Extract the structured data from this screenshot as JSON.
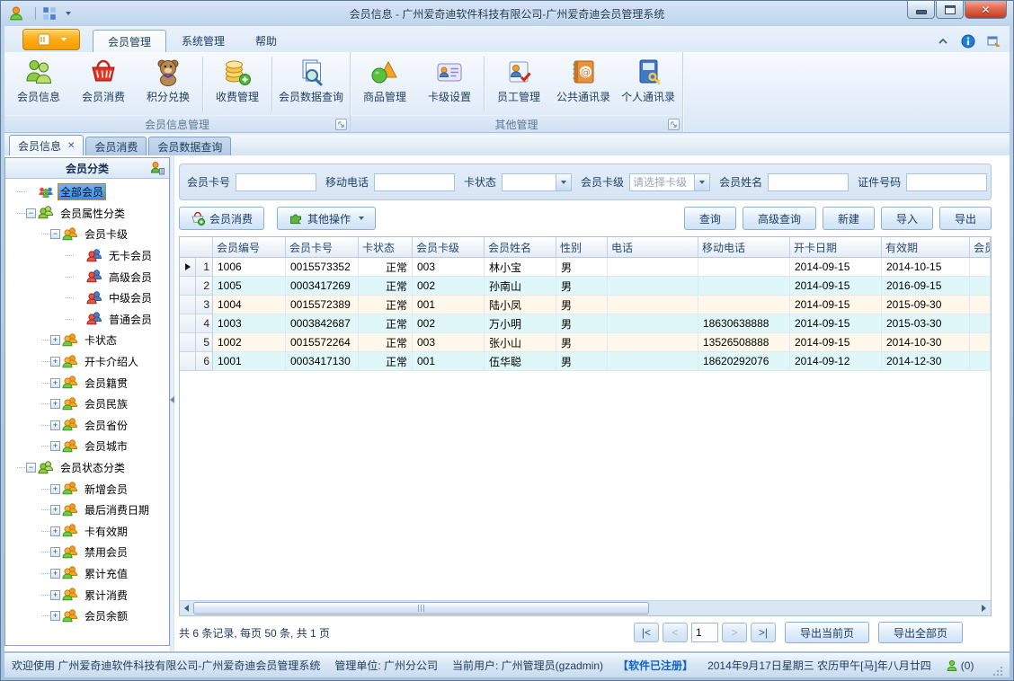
{
  "window": {
    "title": "会员信息 - 广州爱奇迪软件科技有限公司-广州爱奇迪会员管理系统"
  },
  "ribbon": {
    "tabs": [
      {
        "label": "会员管理",
        "active": true
      },
      {
        "label": "系统管理",
        "active": false
      },
      {
        "label": "帮助",
        "active": false
      }
    ],
    "groups": [
      {
        "label": "会员信息管理",
        "buttons": [
          {
            "label": "会员信息",
            "icon": "member-info-icon",
            "sep_after": false
          },
          {
            "label": "会员消费",
            "icon": "member-consume-icon",
            "sep_after": false
          },
          {
            "label": "积分兑换",
            "icon": "points-exchange-icon",
            "sep_after": true
          },
          {
            "label": "收费管理",
            "icon": "fee-management-icon",
            "sep_after": true
          },
          {
            "label": "会员数据查询",
            "icon": "member-data-query-icon",
            "sep_after": false
          }
        ]
      },
      {
        "label": "其他管理",
        "buttons": [
          {
            "label": "商品管理",
            "icon": "goods-management-icon",
            "sep_after": false
          },
          {
            "label": "卡级设置",
            "icon": "card-level-icon",
            "sep_after": true
          },
          {
            "label": "员工管理",
            "icon": "employee-management-icon",
            "sep_after": false
          },
          {
            "label": "公共通讯录",
            "icon": "public-contacts-icon",
            "sep_after": false
          },
          {
            "label": "个人通讯录",
            "icon": "personal-contacts-icon",
            "sep_after": false
          }
        ]
      }
    ]
  },
  "doc_tabs": [
    {
      "label": "会员信息",
      "active": true,
      "closable": true
    },
    {
      "label": "会员消费",
      "active": false,
      "closable": false
    },
    {
      "label": "会员数据查询",
      "active": false,
      "closable": false
    }
  ],
  "sidebar": {
    "header": "会员分类",
    "header_icon": "member-category-settings-icon",
    "tree": [
      {
        "label": "全部会员",
        "level": 0,
        "expander": "none",
        "icon": "all-members-icon",
        "selected": true
      },
      {
        "label": "会员属性分类",
        "level": 0,
        "expander": "minus",
        "icon": "category-green-icon"
      },
      {
        "label": "会员卡级",
        "level": 1,
        "expander": "minus",
        "icon": "category-orange-icon"
      },
      {
        "label": "无卡会员",
        "level": 2,
        "expander": "none",
        "icon": "member-pair-icon"
      },
      {
        "label": "高级会员",
        "level": 2,
        "expander": "none",
        "icon": "member-pair-icon"
      },
      {
        "label": "中级会员",
        "level": 2,
        "expander": "none",
        "icon": "member-pair-icon"
      },
      {
        "label": "普通会员",
        "level": 2,
        "expander": "none",
        "icon": "member-pair-icon"
      },
      {
        "label": "卡状态",
        "level": 1,
        "expander": "plus",
        "icon": "category-orange-icon"
      },
      {
        "label": "开卡介绍人",
        "level": 1,
        "expander": "plus",
        "icon": "category-orange-icon"
      },
      {
        "label": "会员籍贯",
        "level": 1,
        "expander": "plus",
        "icon": "category-orange-icon"
      },
      {
        "label": "会员民族",
        "level": 1,
        "expander": "plus",
        "icon": "category-orange-icon"
      },
      {
        "label": "会员省份",
        "level": 1,
        "expander": "plus",
        "icon": "category-orange-icon"
      },
      {
        "label": "会员城市",
        "level": 1,
        "expander": "plus",
        "icon": "category-orange-icon"
      },
      {
        "label": "会员状态分类",
        "level": 0,
        "expander": "minus",
        "icon": "category-green-icon"
      },
      {
        "label": "新增会员",
        "level": 1,
        "expander": "plus",
        "icon": "category-orange-icon"
      },
      {
        "label": "最后消费日期",
        "level": 1,
        "expander": "plus",
        "icon": "category-orange-icon"
      },
      {
        "label": "卡有效期",
        "level": 1,
        "expander": "plus",
        "icon": "category-orange-icon"
      },
      {
        "label": "禁用会员",
        "level": 1,
        "expander": "plus",
        "icon": "category-orange-icon"
      },
      {
        "label": "累计充值",
        "level": 1,
        "expander": "plus",
        "icon": "category-orange-icon"
      },
      {
        "label": "累计消费",
        "level": 1,
        "expander": "plus",
        "icon": "category-orange-icon"
      },
      {
        "label": "会员余额",
        "level": 1,
        "expander": "plus",
        "icon": "category-orange-icon"
      }
    ]
  },
  "filters": {
    "fields": [
      {
        "label": "会员卡号",
        "type": "text",
        "value": "",
        "placeholder": ""
      },
      {
        "label": "移动电话",
        "type": "text",
        "value": "",
        "placeholder": ""
      },
      {
        "label": "卡状态",
        "type": "combo",
        "value": "",
        "placeholder": ""
      },
      {
        "label": "会员卡级",
        "type": "combo",
        "value": "",
        "placeholder": "请选择卡级"
      },
      {
        "label": "会员姓名",
        "type": "text",
        "value": "",
        "placeholder": ""
      },
      {
        "label": "证件号码",
        "type": "text",
        "value": "",
        "placeholder": ""
      }
    ]
  },
  "toolbar": {
    "member_consume": {
      "label": "会员消费",
      "icon": "basket-add-icon"
    },
    "other_ops": {
      "label": "其他操作",
      "icon": "puzzle-icon",
      "dropdown": true
    },
    "right_buttons": [
      {
        "label": "查询"
      },
      {
        "label": "高级查询"
      },
      {
        "label": "新建"
      },
      {
        "label": "导入"
      },
      {
        "label": "导出"
      }
    ]
  },
  "grid": {
    "columns": [
      "会员编号",
      "会员卡号",
      "卡状态",
      "会员卡级",
      "会员姓名",
      "性别",
      "电话",
      "移动电话",
      "开卡日期",
      "有效期",
      "会员"
    ],
    "rows": [
      {
        "num": "1",
        "current": true,
        "cells": [
          "1006",
          "0015573352",
          "正常",
          "003",
          "林小宝",
          "男",
          "",
          "",
          "2014-09-15",
          "2014-10-15",
          ""
        ]
      },
      {
        "num": "2",
        "current": false,
        "cells": [
          "1005",
          "0003417269",
          "正常",
          "002",
          "孙南山",
          "男",
          "",
          "",
          "2014-09-15",
          "2016-09-15",
          ""
        ]
      },
      {
        "num": "3",
        "current": false,
        "cells": [
          "1004",
          "0015572389",
          "正常",
          "001",
          "陆小凤",
          "男",
          "",
          "",
          "2014-09-15",
          "2015-09-30",
          ""
        ]
      },
      {
        "num": "4",
        "current": false,
        "cells": [
          "1003",
          "0003842687",
          "正常",
          "002",
          "万小明",
          "男",
          "",
          "18630638888",
          "2014-09-15",
          "2015-03-30",
          ""
        ]
      },
      {
        "num": "5",
        "current": false,
        "cells": [
          "1002",
          "0015572264",
          "正常",
          "003",
          "张小山",
          "男",
          "",
          "13526508888",
          "2014-09-15",
          "2014-10-30",
          ""
        ]
      },
      {
        "num": "6",
        "current": false,
        "cells": [
          "1001",
          "0003417130",
          "正常",
          "001",
          "伍华聪",
          "男",
          "",
          "18620292076",
          "2014-09-12",
          "2014-12-30",
          ""
        ]
      }
    ]
  },
  "pager": {
    "summary": "共 6 条记录, 每页 50 条, 共 1 页",
    "first": "|<",
    "prev": "<",
    "page_value": "1",
    "next": ">",
    "last": ">|",
    "export_current": "导出当前页",
    "export_all": "导出全部页"
  },
  "statusbar": {
    "welcome": "欢迎使用 广州爱奇迪软件科技有限公司-广州爱奇迪会员管理系统",
    "org": "管理单位: 广州分公司",
    "user": "当前用户: 广州管理员(gzadmin)",
    "license": "【软件已注册】",
    "datetime": "2014年9月17日星期三 农历甲午[马]年八月廿四",
    "counter": "(0)"
  }
}
